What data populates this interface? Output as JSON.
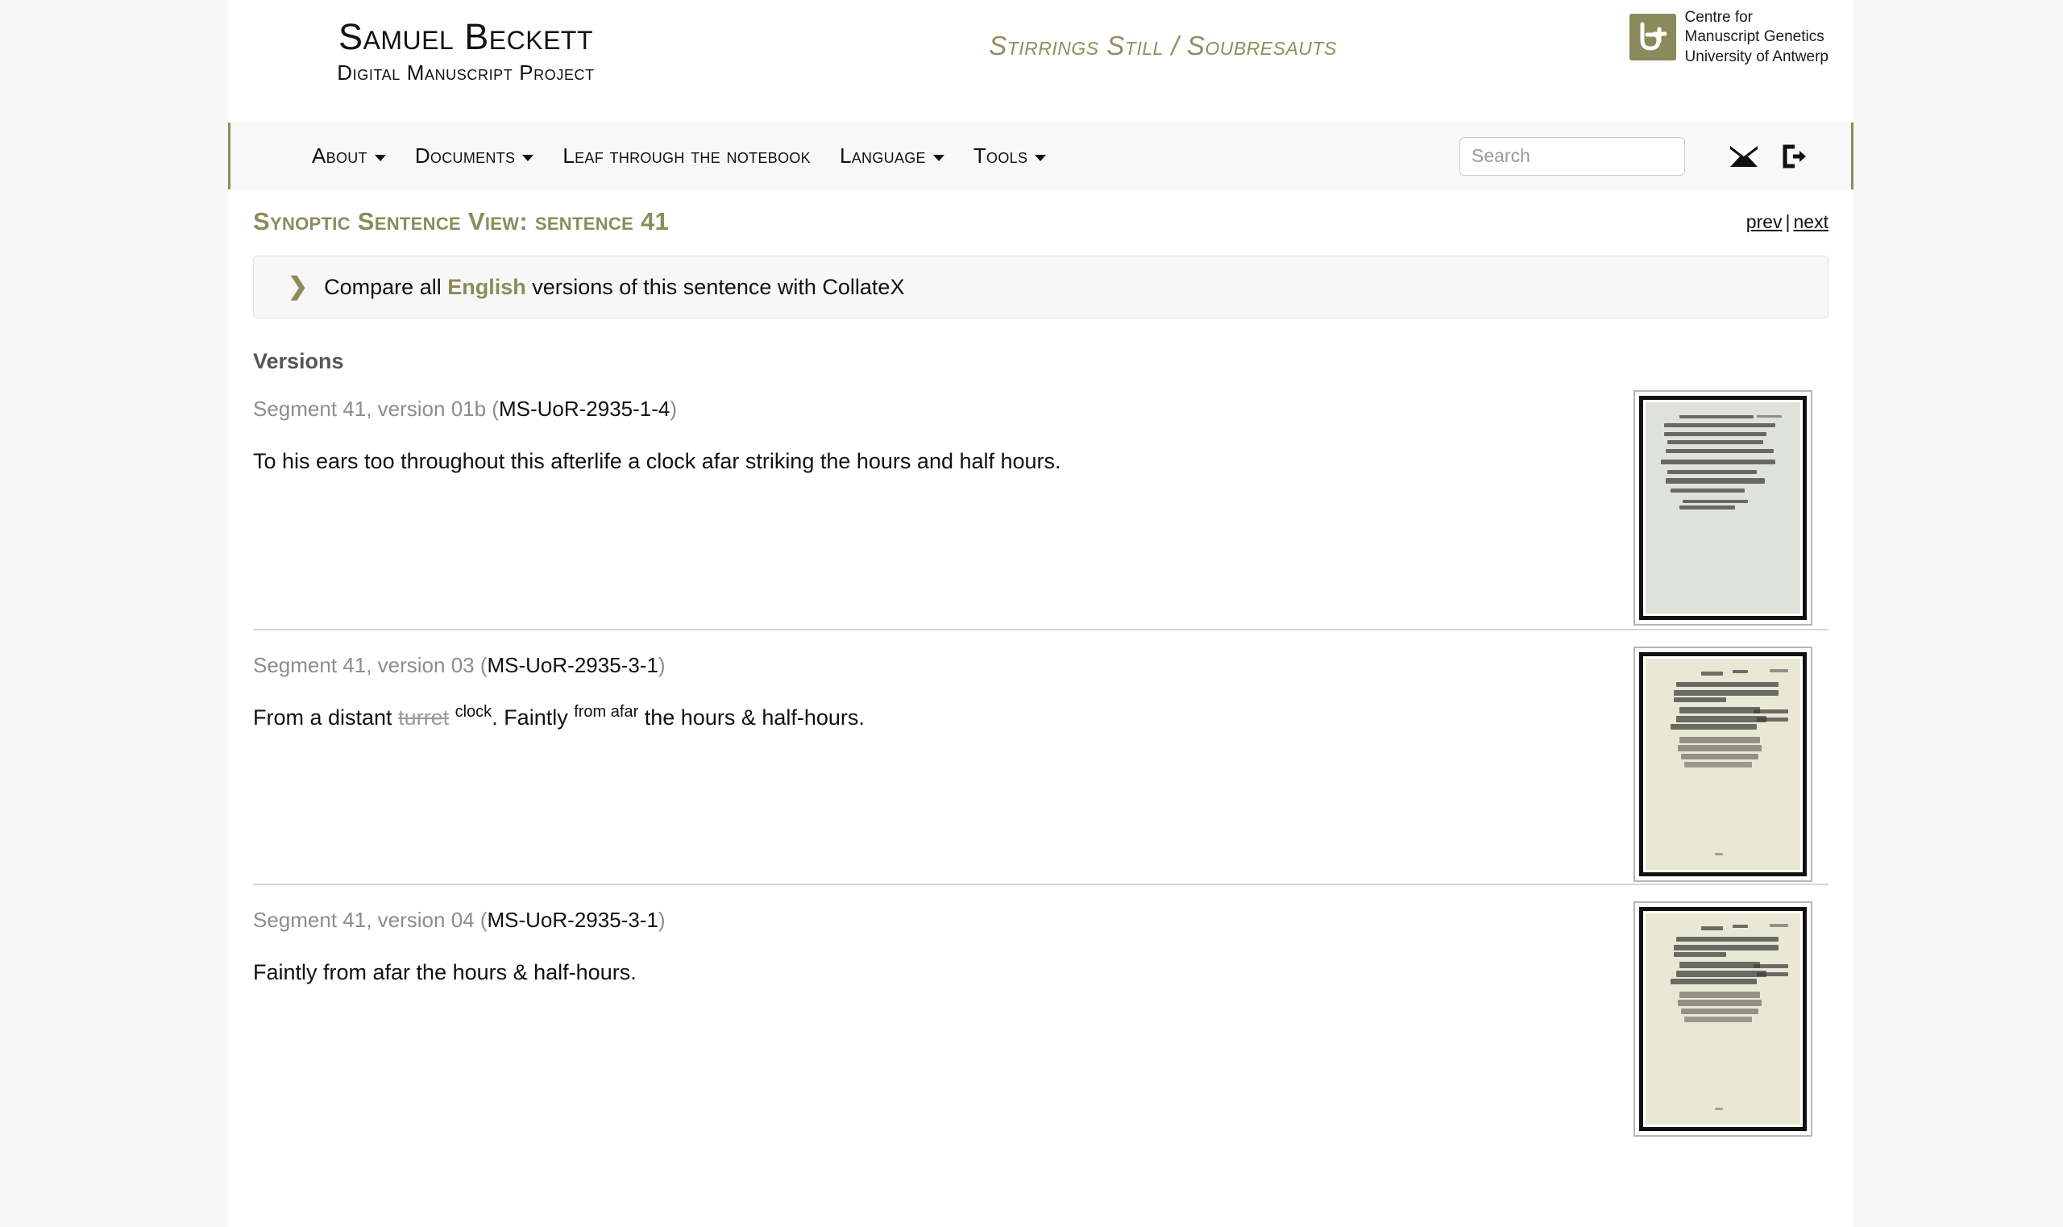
{
  "masthead": {
    "site_title": "Samuel Beckett",
    "site_subtitle": "Digital Manuscript Project",
    "work_title": "Stirrings Still / Soubresauts",
    "logo": {
      "line1": "Centre for",
      "line2": "Manuscript Genetics",
      "line3": "University of Antwerp",
      "mark_color": "#8a8a5c"
    }
  },
  "navbar": {
    "items": [
      {
        "label": "About",
        "has_caret": true
      },
      {
        "label": "Documents",
        "has_caret": true
      },
      {
        "label": "Leaf through the notebook",
        "has_caret": false
      },
      {
        "label": "Language",
        "has_caret": true
      },
      {
        "label": "Tools",
        "has_caret": true
      }
    ],
    "search": {
      "placeholder": "Search",
      "value": ""
    },
    "icons": [
      {
        "name": "mail-icon"
      },
      {
        "name": "sign-out-icon"
      }
    ],
    "accent_color": "#8d8b59"
  },
  "main": {
    "heading": "Synoptic Sentence View: sentence 41",
    "pager": {
      "prev": "prev",
      "separator": "|",
      "next": "next"
    },
    "collate": {
      "chevron": "❯",
      "prefix": "Compare all ",
      "highlight": "English",
      "suffix": " versions of this sentence with CollateX"
    },
    "versions_label": "Versions",
    "versions": [
      {
        "head_prefix": "Segment 41, version 01b (",
        "sigil": "MS-UoR-2935-1-4",
        "head_suffix": ")",
        "text_plain": "To his ears too throughout this afterlife a clock afar striking the hours and half hours.",
        "thumbnail": "ms-a"
      },
      {
        "head_prefix": "Segment 41, version 03 (",
        "sigil": "MS-UoR-2935-3-1",
        "head_suffix": ")",
        "text_parts": [
          {
            "kind": "plain",
            "text": "From a distant "
          },
          {
            "kind": "deleted",
            "text": "turret"
          },
          {
            "kind": "plain",
            "text": " "
          },
          {
            "kind": "added",
            "text": "clock"
          },
          {
            "kind": "plain",
            "text": ". Faintly "
          },
          {
            "kind": "added",
            "text": "from afar"
          },
          {
            "kind": "plain",
            "text": " the hours & half-hours."
          }
        ],
        "thumbnail": "ms-b"
      },
      {
        "head_prefix": "Segment 41, version 04 (",
        "sigil": "MS-UoR-2935-3-1",
        "head_suffix": ")",
        "text_plain": "Faintly from afar the hours & half-hours.",
        "thumbnail": "ms-b"
      }
    ]
  }
}
